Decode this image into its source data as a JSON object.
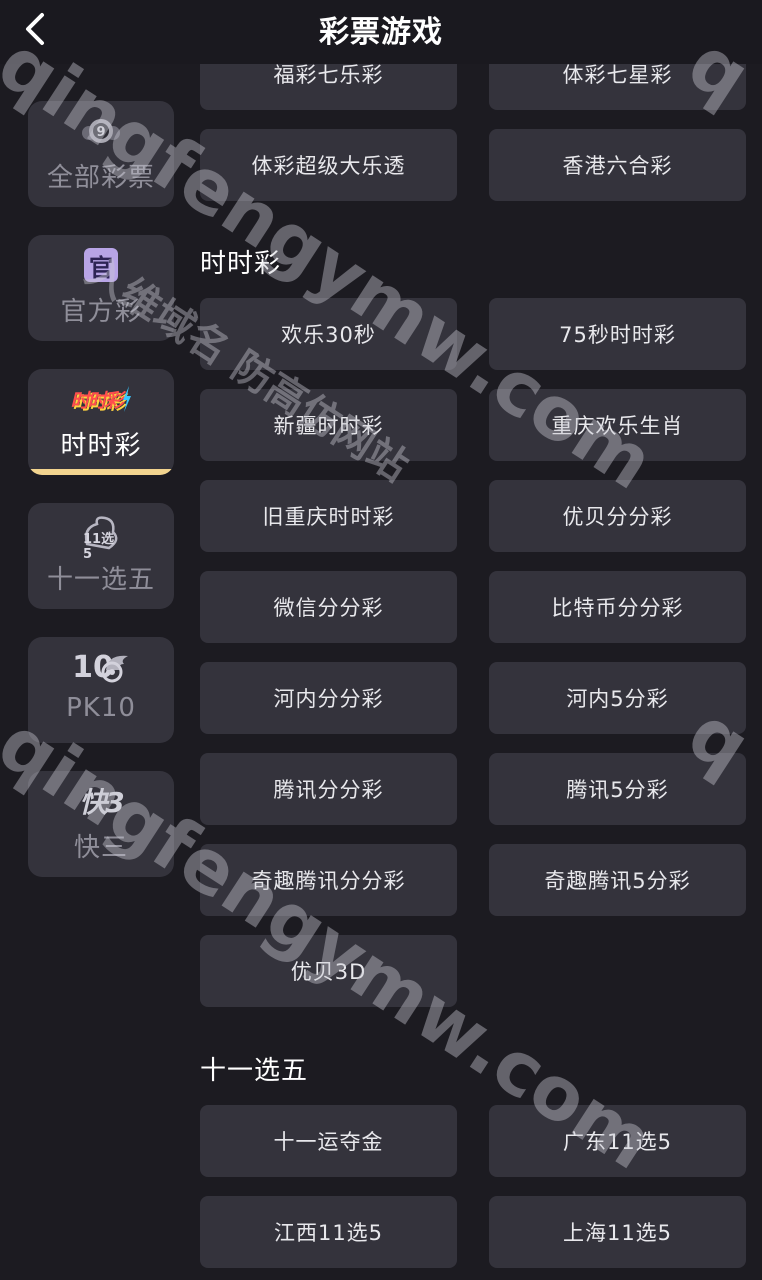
{
  "header": {
    "title": "彩票游戏"
  },
  "sidebar": {
    "items": [
      {
        "label": "全部彩票"
      },
      {
        "label": "官方彩",
        "icon_text": "官"
      },
      {
        "label": "时时彩",
        "icon_text": "时时彩",
        "active": true
      },
      {
        "label": "十一选五",
        "icon_text": "11选5"
      },
      {
        "label": "PK10",
        "icon_text": "10"
      },
      {
        "label": "快三",
        "icon_text": "快3"
      }
    ]
  },
  "top_games": [
    "福彩七乐彩",
    "体彩七星彩",
    "体彩超级大乐透",
    "香港六合彩"
  ],
  "sections": [
    {
      "title": "时时彩",
      "games": [
        "欢乐30秒",
        "75秒时时彩",
        "新疆时时彩",
        "重庆欢乐生肖",
        "旧重庆时时彩",
        "优贝分分彩",
        "微信分分彩",
        "比特币分分彩",
        "河内分分彩",
        "河内5分彩",
        "腾讯分分彩",
        "腾讯5分彩",
        "奇趣腾讯分分彩",
        "奇趣腾讯5分彩",
        "优贝3D"
      ]
    },
    {
      "title": "十一选五",
      "games": [
        "十一运夺金",
        "广东11选5",
        "江西11选5",
        "上海11选5"
      ]
    }
  ],
  "watermark": {
    "domain": "qingfengymw.com",
    "cn_text": "入维域名 防高仿网站",
    "edge_letter": "q"
  },
  "colors": {
    "background": "#1c1b21",
    "tile": "#34333c",
    "active_underline": "#f2d48f"
  }
}
